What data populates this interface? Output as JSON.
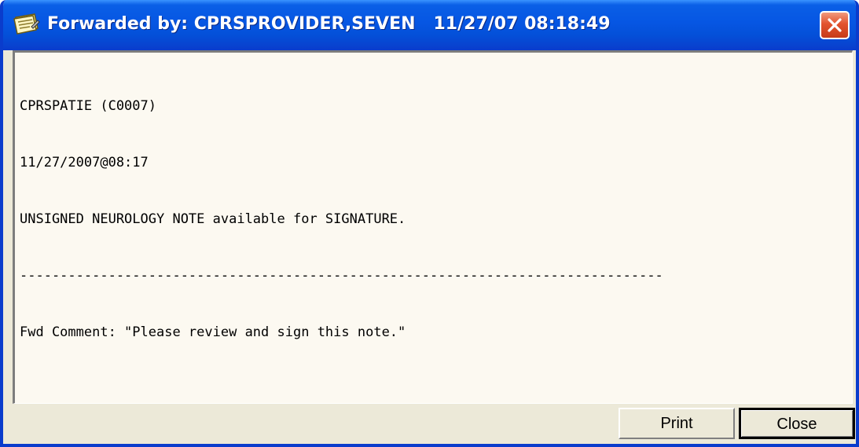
{
  "window": {
    "title": "Forwarded by: CPRSPROVIDER,SEVEN   11/27/07 08:18:49",
    "title_icon": "note-icon",
    "close_icon": "close-icon"
  },
  "memo": {
    "lines": [
      "CPRSPATIE (C0007)",
      "11/27/2007@08:17",
      "UNSIGNED NEUROLOGY NOTE available for SIGNATURE.",
      "--------------------------------------------------------------------------------",
      "Fwd Comment: \"Please review and sign this note.\""
    ]
  },
  "buttons": {
    "print_label": "Print",
    "close_label": "Close"
  },
  "colors": {
    "titlebar": "#0656e3",
    "close_button": "#e2532e",
    "memo_background": "#fcf9f1",
    "dialog_face": "#ece9d8"
  }
}
